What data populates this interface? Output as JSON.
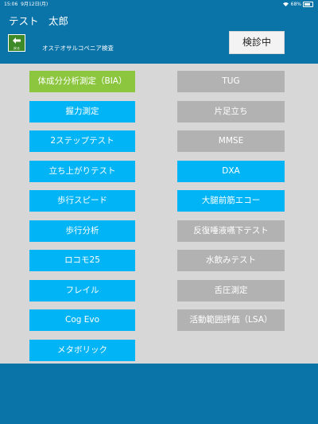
{
  "status_bar": {
    "time": "15:06",
    "date": "9月12日(月)",
    "battery": "68%"
  },
  "header": {
    "patient_name": "テスト　太郎",
    "back_label": "戻る",
    "screen_title": "オステオサルコペニア検査",
    "status_button_label": "検診中"
  },
  "colors": {
    "header_bg": "#0a73a8",
    "panel_bg": "#d7d7d7",
    "completed": "#8cc63f",
    "available": "#00b4f5",
    "unavailable": "#b2b2b2"
  },
  "tests_left": [
    {
      "label": "体成分分析測定（BIA）",
      "state": "completed"
    },
    {
      "label": "握力測定",
      "state": "available"
    },
    {
      "label": "2ステップテスト",
      "state": "available"
    },
    {
      "label": "立ち上がりテスト",
      "state": "available"
    },
    {
      "label": "歩行スピード",
      "state": "available"
    },
    {
      "label": "歩行分析",
      "state": "available"
    },
    {
      "label": "ロコモ25",
      "state": "available"
    },
    {
      "label": "フレイル",
      "state": "available"
    },
    {
      "label": "Cog Evo",
      "state": "available"
    },
    {
      "label": "メタボリック",
      "state": "available"
    }
  ],
  "tests_right": [
    {
      "label": "TUG",
      "state": "unavailable"
    },
    {
      "label": "片足立ち",
      "state": "unavailable"
    },
    {
      "label": "MMSE",
      "state": "unavailable"
    },
    {
      "label": "DXA",
      "state": "available"
    },
    {
      "label": "大腿前筋エコー",
      "state": "available"
    },
    {
      "label": "反復唾液嚥下テスト",
      "state": "unavailable"
    },
    {
      "label": "水飲みテスト",
      "state": "unavailable"
    },
    {
      "label": "舌圧測定",
      "state": "unavailable"
    },
    {
      "label": "活動範囲評価（LSA）",
      "state": "unavailable"
    }
  ]
}
